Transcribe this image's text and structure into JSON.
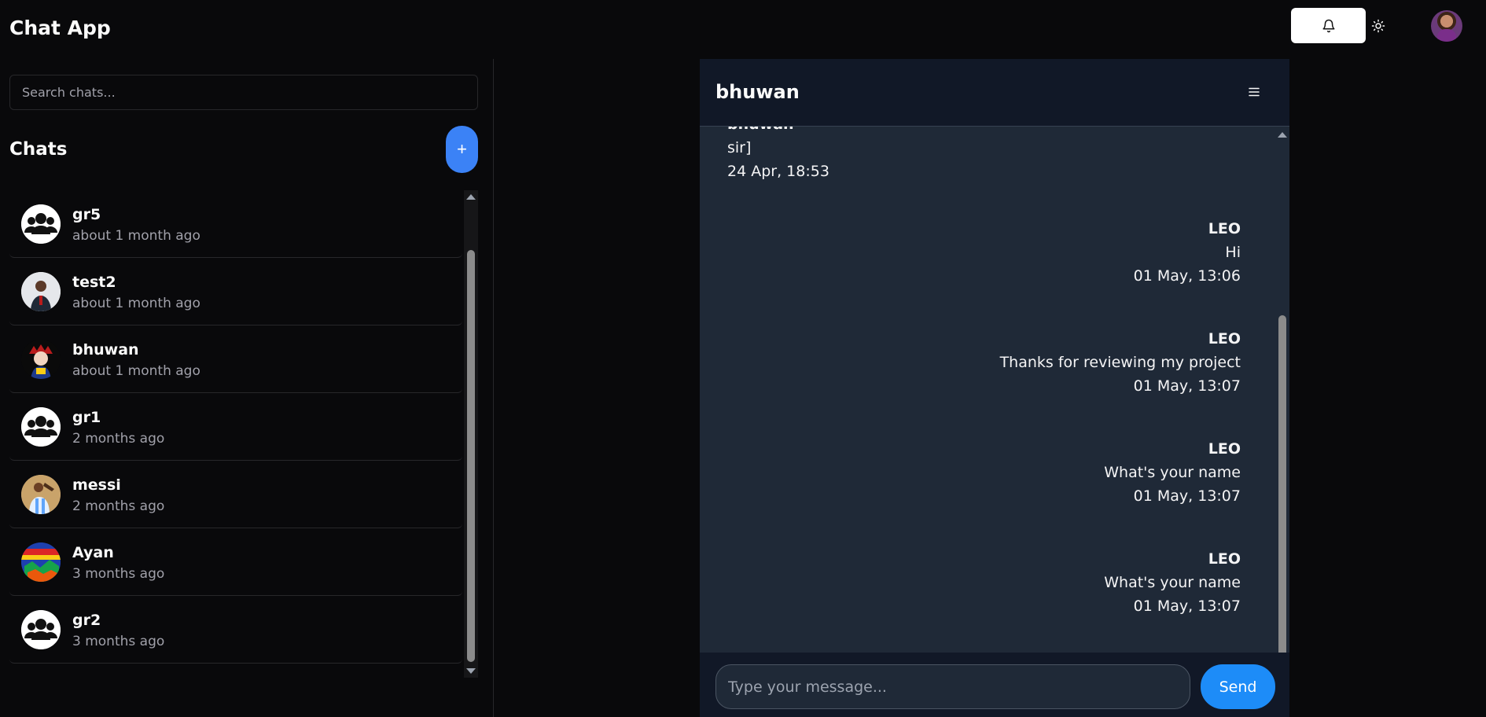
{
  "header": {
    "title": "Chat App",
    "notifications_icon": "bell-icon",
    "theme_icon": "sun-icon",
    "user_avatar": "user-avatar"
  },
  "sidebar": {
    "search_placeholder": "Search chats...",
    "heading": "Chats",
    "new_chat_label": "+",
    "items": [
      {
        "name": "gr5",
        "time": "about 1 month ago",
        "avatar": "group-icon"
      },
      {
        "name": "test2",
        "time": "about 1 month ago",
        "avatar": "photo"
      },
      {
        "name": "bhuwan",
        "time": "about 1 month ago",
        "avatar": "photo"
      },
      {
        "name": "gr1",
        "time": "2 months ago",
        "avatar": "group-icon"
      },
      {
        "name": "messi",
        "time": "2 months ago",
        "avatar": "photo"
      },
      {
        "name": "Ayan",
        "time": "3 months ago",
        "avatar": "photo"
      },
      {
        "name": "gr2",
        "time": "3 months ago",
        "avatar": "group-icon"
      }
    ]
  },
  "chat": {
    "title": "bhuwan",
    "menu_icon": "menu-icon",
    "messages": [
      {
        "sender": "bhuwan",
        "text": "sir]",
        "time": "24 Apr, 18:53",
        "side": "left"
      },
      {
        "sender": "LEO",
        "text": "Hi",
        "time": "01 May, 13:06",
        "side": "right"
      },
      {
        "sender": "LEO",
        "text": "Thanks for reviewing my project",
        "time": "01 May, 13:07",
        "side": "right"
      },
      {
        "sender": "LEO",
        "text": "What's your name",
        "time": "01 May, 13:07",
        "side": "right"
      },
      {
        "sender": "LEO",
        "text": "What's your name",
        "time": "01 May, 13:07",
        "side": "right"
      }
    ],
    "input_placeholder": "Type your message...",
    "send_label": "Send"
  },
  "colors": {
    "background": "#09090b",
    "accent": "#3b82f6",
    "send": "#1d8cf8",
    "chat_panel": "#1f2937"
  }
}
